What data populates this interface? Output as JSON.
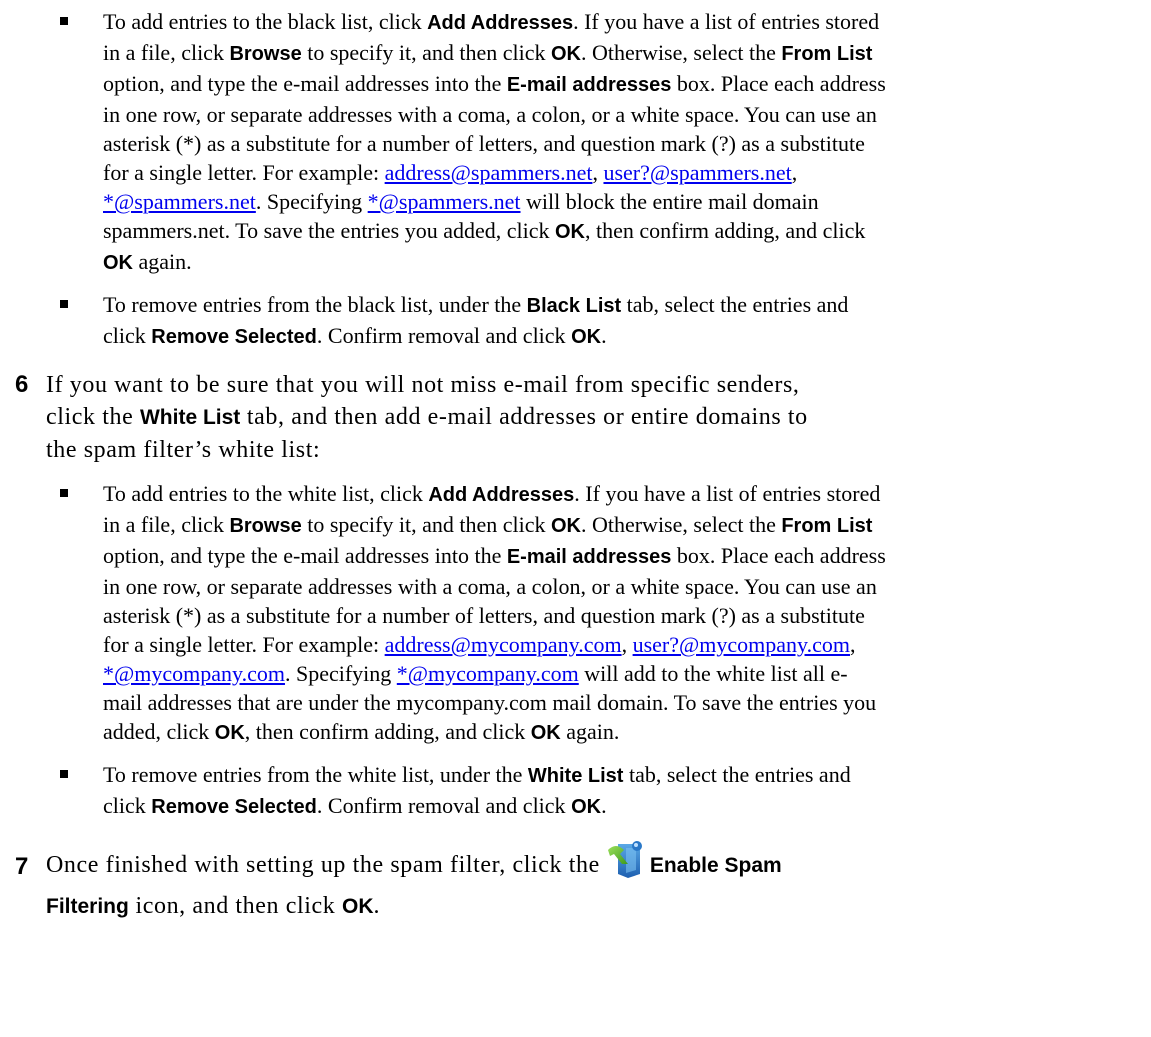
{
  "black_list": {
    "add": {
      "l1": [
        "To add entries to the black list, click ",
        "Add Addresses",
        ". If you have a list of entries stored"
      ],
      "l2": [
        "in a file, click ",
        "Browse",
        " to specify it, and then click ",
        "OK",
        ". Otherwise, select the ",
        "From List"
      ],
      "l3": [
        "option, and type the e-mail addresses into the ",
        "E-mail addresses",
        " box. Place each address"
      ],
      "l4": "in one row, or separate addresses with a coma, a colon, or a white space. You can use an",
      "l5": "asterisk (*) as a substitute for a number of letters, and question mark (?) as a substitute",
      "l6": [
        "for a single letter. For example: ",
        "address@spammers.net",
        ", ",
        "user?@spammers.net",
        ","
      ],
      "l7": [
        "*@spammers.net",
        ". Specifying ",
        "*@spammers.net",
        " will block the entire mail domain"
      ],
      "l8": [
        "spammers.net. To save the entries you added, click ",
        "OK",
        ", then confirm adding, and click"
      ],
      "l9": [
        "OK",
        " again."
      ]
    },
    "remove": {
      "l1": [
        "To remove entries from the black list, under the ",
        "Black List",
        " tab, select the entries and"
      ],
      "l2": [
        "click ",
        "Remove Selected",
        ". Confirm removal and click ",
        "OK",
        "."
      ]
    }
  },
  "step6": {
    "number": "6",
    "l1": "If you want to be sure that you will not miss e-mail from specific senders,",
    "l2": [
      "click the ",
      "White List",
      " tab, and then add e-mail addresses or entire domains to"
    ],
    "l3": "the spam filter’s white list:"
  },
  "white_list": {
    "add": {
      "l1": [
        "To add entries to the white list, click ",
        "Add Addresses",
        ". If you have a list of entries stored"
      ],
      "l2": [
        "in a file, click ",
        "Browse",
        " to specify it, and then click ",
        "OK",
        ". Otherwise, select the ",
        "From List"
      ],
      "l3": [
        "option, and type the e-mail addresses into the ",
        "E-mail addresses",
        " box. Place each address"
      ],
      "l4": "in one row, or separate addresses with a coma, a colon, or a white space. You can use an",
      "l5": "asterisk (*) as a substitute for a number of letters, and question mark (?) as a substitute",
      "l6": [
        "for a single letter. For example: ",
        "address@mycompany.com",
        ", ",
        "user?@mycompany.com",
        ","
      ],
      "l7": [
        "*@mycompany.com",
        ". Specifying ",
        "*@mycompany.com",
        " will add to the white list all e-"
      ],
      "l8": "mail addresses that are under the mycompany.com mail domain. To save the entries you",
      "l9": [
        "added, click ",
        "OK",
        ", then confirm adding, and click ",
        "OK",
        " again."
      ]
    },
    "remove": {
      "l1": [
        "To remove entries from the white list, under the ",
        "White List",
        " tab, select the entries and"
      ],
      "l2": [
        "click ",
        "Remove Selected",
        ". Confirm removal and click ",
        "OK",
        "."
      ]
    }
  },
  "step7": {
    "number": "7",
    "l1": [
      "Once finished with setting up the spam filter, click the",
      "Enable Spam"
    ],
    "icon": "spam-filter-toggle-icon",
    "l2": [
      "Filtering",
      " icon, and then click ",
      "OK",
      "."
    ]
  }
}
